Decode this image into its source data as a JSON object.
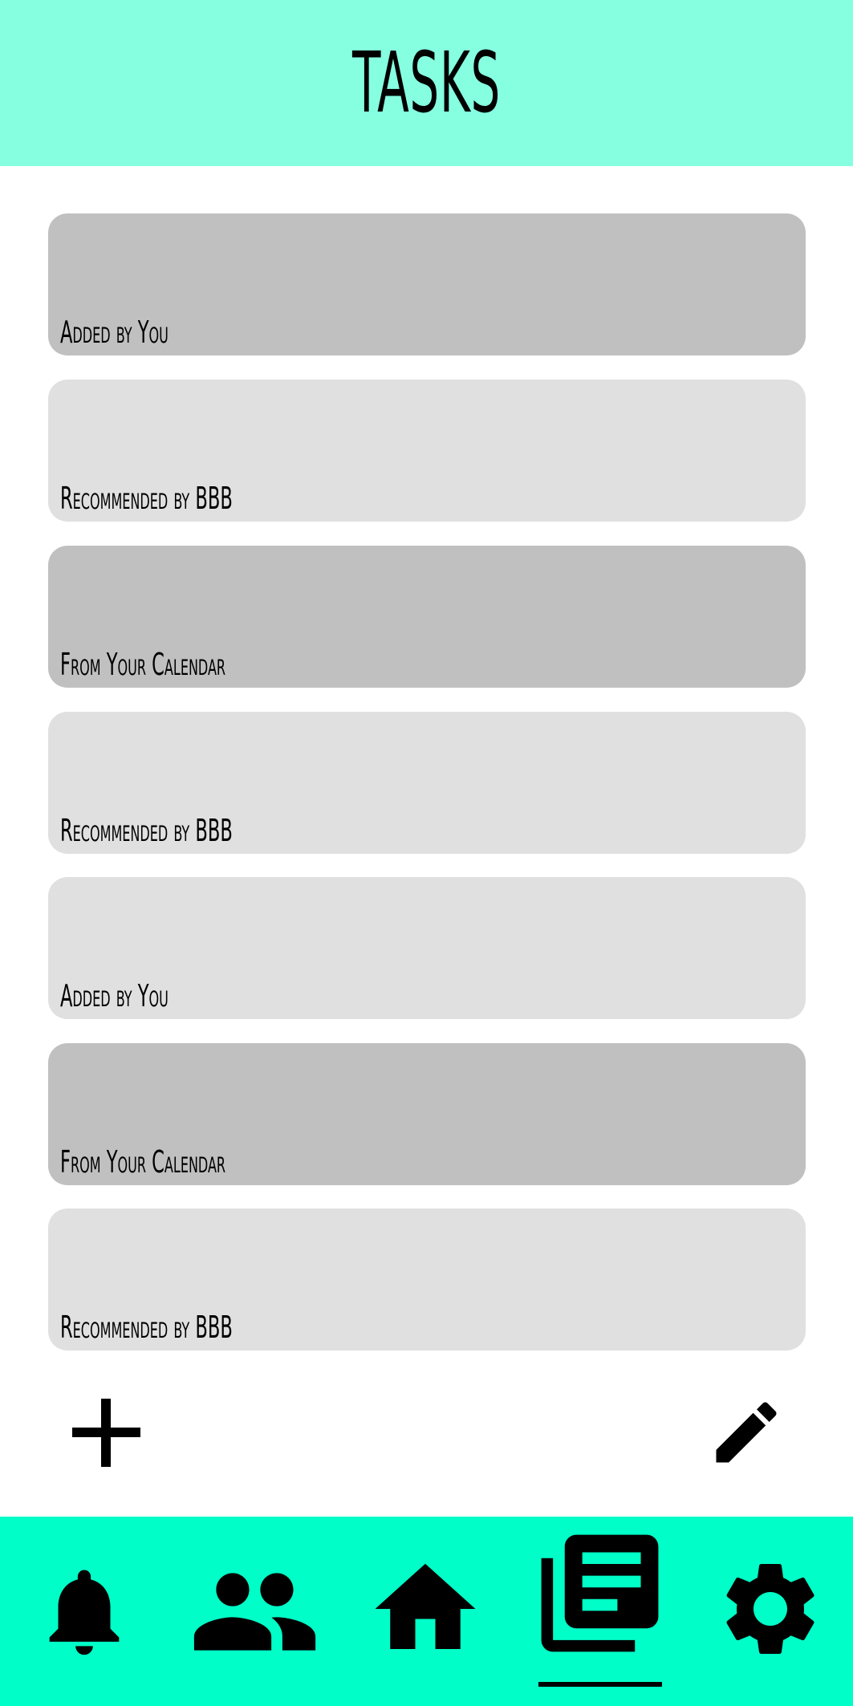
{
  "header": {
    "title": "TASKS",
    "background": "#86ffe1"
  },
  "tasks": [
    {
      "label": "Added by You",
      "color": "#c0c0c0"
    },
    {
      "label": "Recommended by BBB",
      "color": "#e0e0e0"
    },
    {
      "label": "From Your Calendar",
      "color": "#c0c0c0"
    },
    {
      "label": "Recommended by BBB",
      "color": "#e0e0e0"
    },
    {
      "label": "Added by You",
      "color": "#e0e0e0"
    },
    {
      "label": "From Your Calendar",
      "color": "#c0c0c0"
    },
    {
      "label": "Recommended by BBB",
      "color": "#e0e0e0"
    }
  ],
  "actions": {
    "add_icon": "plus-icon",
    "edit_icon": "pencil-icon"
  },
  "navbar": {
    "background": "#00ffc8",
    "items": [
      {
        "icon": "bell-icon",
        "active": false
      },
      {
        "icon": "people-icon",
        "active": false
      },
      {
        "icon": "home-icon",
        "active": false
      },
      {
        "icon": "tasks-icon",
        "active": true
      },
      {
        "icon": "gear-icon",
        "active": false
      }
    ]
  }
}
